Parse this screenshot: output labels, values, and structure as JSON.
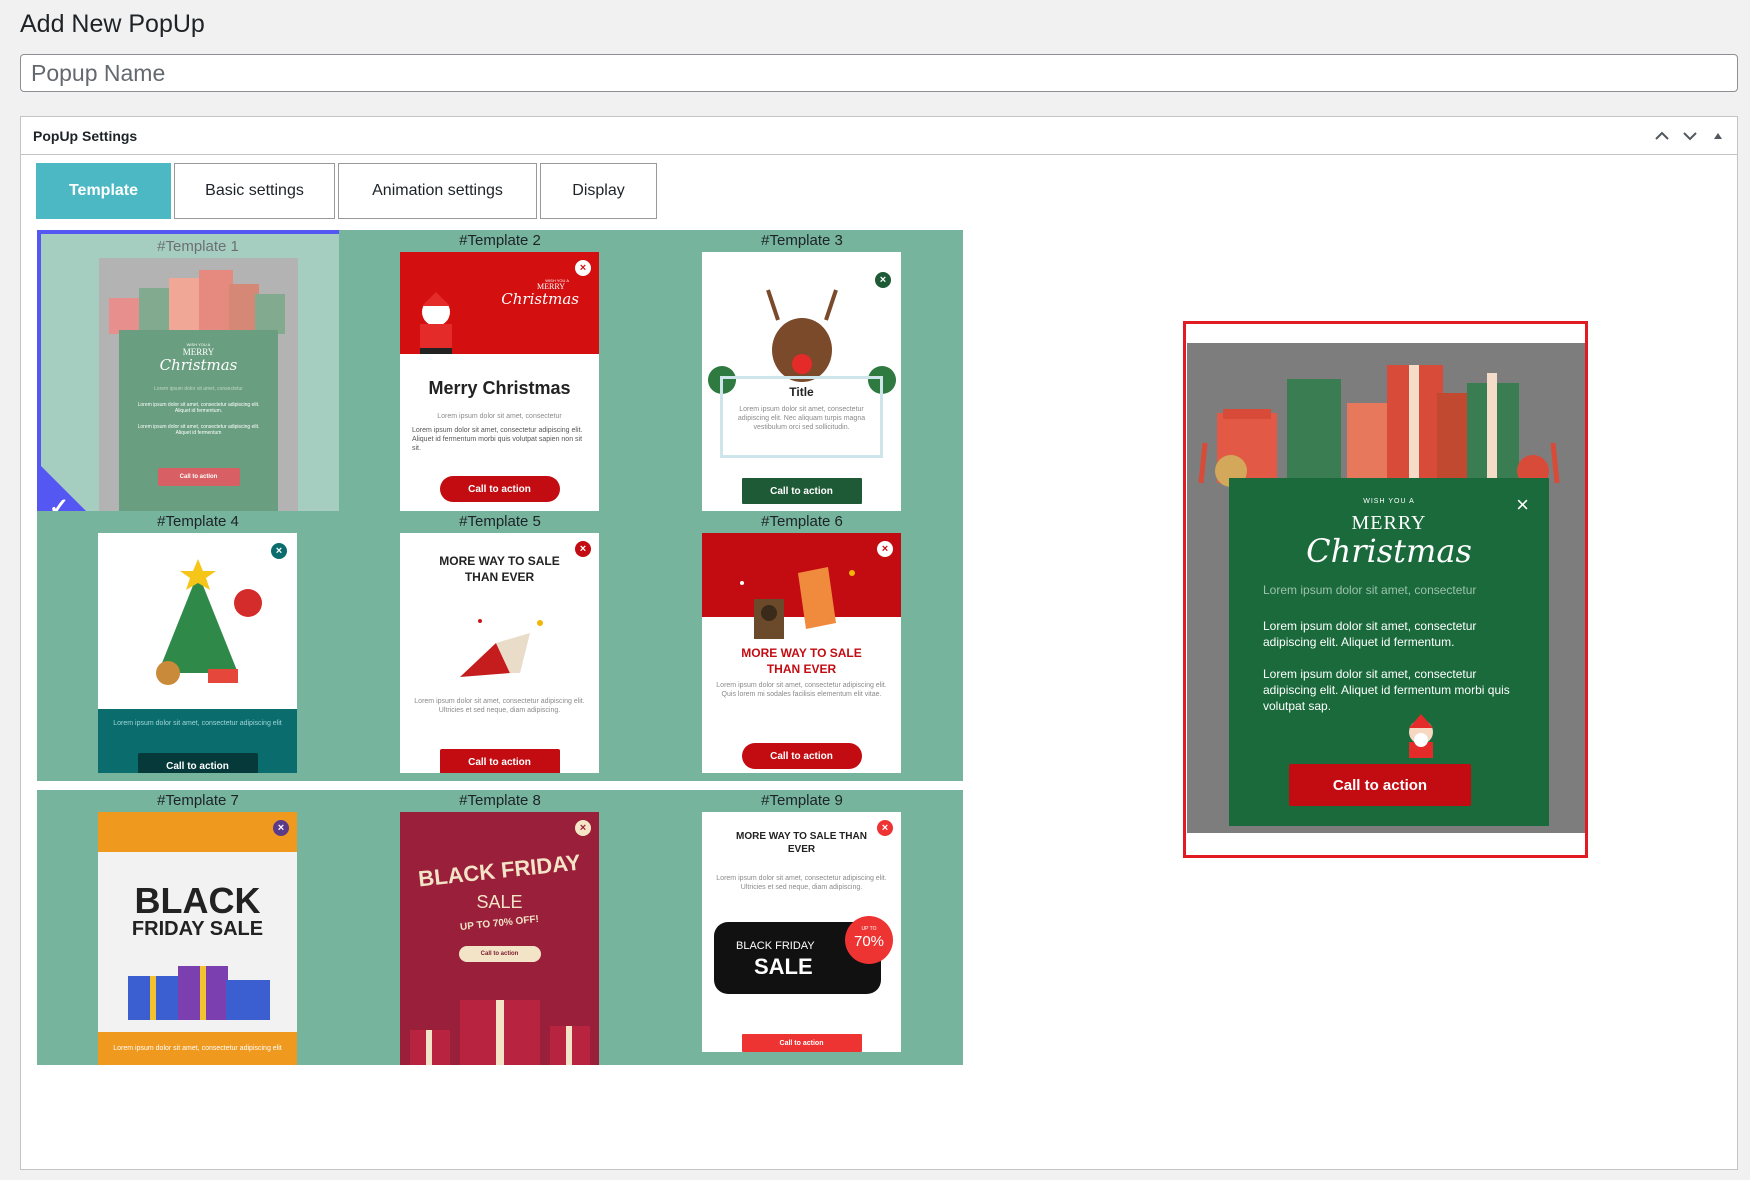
{
  "page": {
    "title": "Add New PopUp"
  },
  "popup_name": {
    "placeholder": "Popup Name",
    "value": ""
  },
  "settings_box": {
    "title": "PopUp Settings",
    "actions": [
      "chevron-up-icon",
      "chevron-down-icon",
      "triangle-up-icon"
    ]
  },
  "tabs": [
    {
      "label": "Template",
      "active": true
    },
    {
      "label": "Basic settings",
      "active": false
    },
    {
      "label": "Animation settings",
      "active": false
    },
    {
      "label": "Display",
      "active": false
    }
  ],
  "templates": [
    {
      "label": "#Template 1",
      "selected": true,
      "small": "WISH YOU A",
      "merry": "MERRY",
      "christmas": "Christmas",
      "lines": [
        "Lorem ipsum dolor sit amet, consectetur",
        "Lorem ipsum dolor sit amet, consectetur adipiscing elit. Aliquet id fermentum.",
        "Lorem ipsum dolor sit amet, consectetur adipiscing elit. Aliquet id fermentum"
      ],
      "cta": "Call to action"
    },
    {
      "label": "#Template 2",
      "selected": false,
      "small": "WISH YOU A",
      "merry": "MERRY",
      "christmas": "Christmas",
      "heading": "Merry Christmas",
      "lines": [
        "Lorem ipsum dolor sit amet, consectetur",
        "Lorem ipsum dolor sit amet, consectetur adipiscing elit. Aliquet id fermentum morbi quis volutpat sapien non sit sit."
      ],
      "cta": "Call to action"
    },
    {
      "label": "#Template 3",
      "selected": false,
      "heading": "Title",
      "lines": [
        "Lorem ipsum dolor sit amet, consectetur adipiscing elit. Nec aliquam turpis magna vestibulum orci sed sollicitudin."
      ],
      "cta": "Call to action"
    },
    {
      "label": "#Template 4",
      "selected": false,
      "lines": [
        "Lorem ipsum dolor sit amet, consectetur adipiscing elit"
      ],
      "cta": "Call to action"
    },
    {
      "label": "#Template 5",
      "selected": false,
      "heading": "MORE WAY TO SALE THAN EVER",
      "lines": [
        "Lorem ipsum dolor sit amet, consectetur adipiscing elit. Ultricies et sed neque, diam adipiscing."
      ],
      "cta": "Call to action"
    },
    {
      "label": "#Template 6",
      "selected": false,
      "heading": "MORE WAY TO SALE THAN EVER",
      "lines": [
        "Lorem ipsum dolor sit amet, consectetur adipiscing elit. Quis lorem mi sodales facilisis elementum elit vitae."
      ],
      "cta": "Call to action"
    },
    {
      "label": "#Template 7",
      "selected": false,
      "big1": "BLACK",
      "big2": "FRIDAY SALE",
      "lines": [
        "Lorem ipsum dolor sit amet, consectetur adipiscing elit"
      ],
      "cta": ""
    },
    {
      "label": "#Template 8",
      "selected": false,
      "big1": "BLACK FRIDAY",
      "big2": "SALE",
      "sub": "UP TO 70% OFF!",
      "lines": [],
      "cta": "Call to action"
    },
    {
      "label": "#Template 9",
      "selected": false,
      "heading": "MORE WAY TO SALE THAN EVER",
      "big1": "BLACK FRIDAY",
      "big2": "SALE",
      "badge_small": "UP TO",
      "badge": "70%",
      "lines": [
        "Lorem ipsum dolor sit amet, consectetur adipiscing elit. Ultricies et sed neque, diam adipiscing."
      ],
      "cta": "Call to action"
    }
  ],
  "preview": {
    "small": "WISH YOU A",
    "merry": "MERRY",
    "christmas": "Christmas",
    "line1": "Lorem ipsum dolor sit amet, consectetur",
    "line2": "Lorem ipsum dolor sit amet, consectetur adipiscing elit. Aliquet id fermentum.",
    "line3": "Lorem ipsum dolor sit amet, consectetur adipiscing elit. Aliquet id fermentum morbi quis volutpat sap.",
    "cta": "Call to action",
    "close": "×"
  },
  "colors": {
    "accent": "#4cb8c4",
    "card_bg": "#76b49e",
    "selected_border": "#5457f2",
    "preview_border": "#e01b22",
    "christmas_green": "#1a6a3c",
    "christmas_red": "#c30c12"
  }
}
